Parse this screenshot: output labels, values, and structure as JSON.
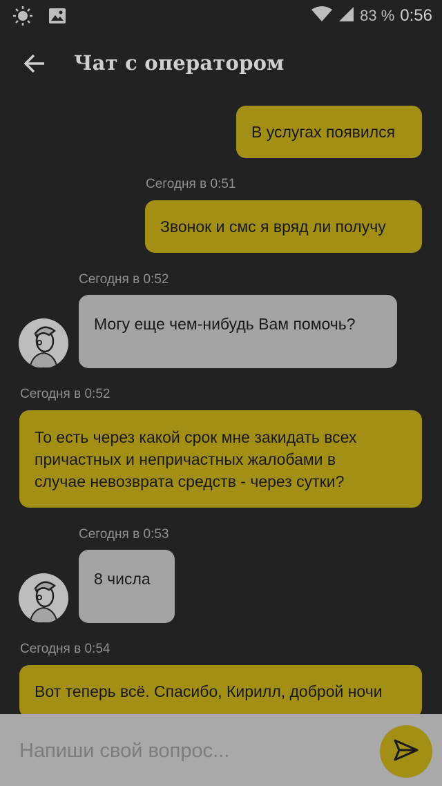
{
  "status_bar": {
    "battery_percent": "83 %",
    "time": "0:56"
  },
  "header": {
    "title": "Чат с оператором"
  },
  "messages": [
    {
      "sender": "user",
      "text": "В услугах появился"
    },
    {
      "timestamp": "Сегодня в 0:51",
      "sender": "user",
      "text": "Звонок и смс я вряд ли получу"
    },
    {
      "timestamp": "Сегодня в 0:52",
      "sender": "operator",
      "text": "Могу еще чем-нибудь Вам помочь?"
    },
    {
      "timestamp": "Сегодня в 0:52",
      "sender": "user",
      "lines": [
        "То есть через какой срок мне закидать всех",
        "причастных и непричастных жалобами в",
        "случае невозврата средств - через сутки?"
      ]
    },
    {
      "timestamp": "Сегодня в 0:53",
      "sender": "operator",
      "text": "8 числа"
    },
    {
      "timestamp": "Сегодня в 0:54",
      "sender": "user",
      "text": "Вот теперь всё. Спасибо, Кирилл, доброй ночи"
    }
  ],
  "input": {
    "placeholder": "Напиши свой вопрос..."
  },
  "colors": {
    "background": "#222222",
    "user_bubble": "#a38f15",
    "operator_bubble": "#a4a4a4",
    "input_bar": "#a9a9a9"
  }
}
